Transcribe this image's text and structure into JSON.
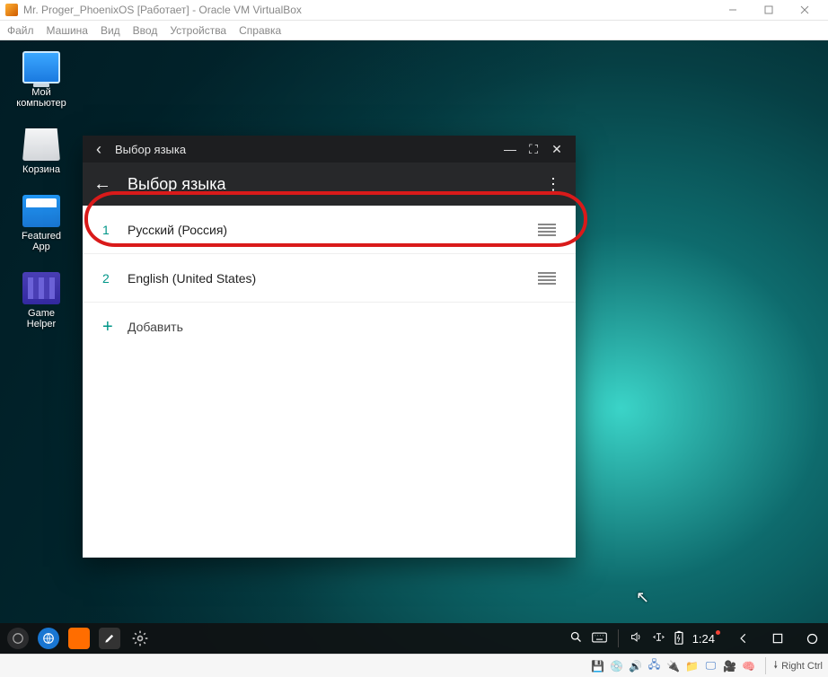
{
  "virtualbox": {
    "title": "Mr. Proger_PhoenixOS [Работает] - Oracle VM VirtualBox",
    "menu": {
      "file": "Файл",
      "machine": "Машина",
      "view": "Вид",
      "input": "Ввод",
      "devices": "Устройства",
      "help": "Справка"
    },
    "hostkey": "Right Ctrl"
  },
  "desktop": {
    "computer": "Мой компьютер",
    "trash": "Корзина",
    "featured": "Featured App",
    "gamehelper": "Game Helper"
  },
  "window": {
    "titlebar": "Выбор языка",
    "appbar": "Выбор языка",
    "languages": [
      {
        "num": "1",
        "name": "Русский (Россия)"
      },
      {
        "num": "2",
        "name": "English (United States)"
      }
    ],
    "add": "Добавить"
  },
  "taskbar": {
    "clock": "1:24"
  }
}
